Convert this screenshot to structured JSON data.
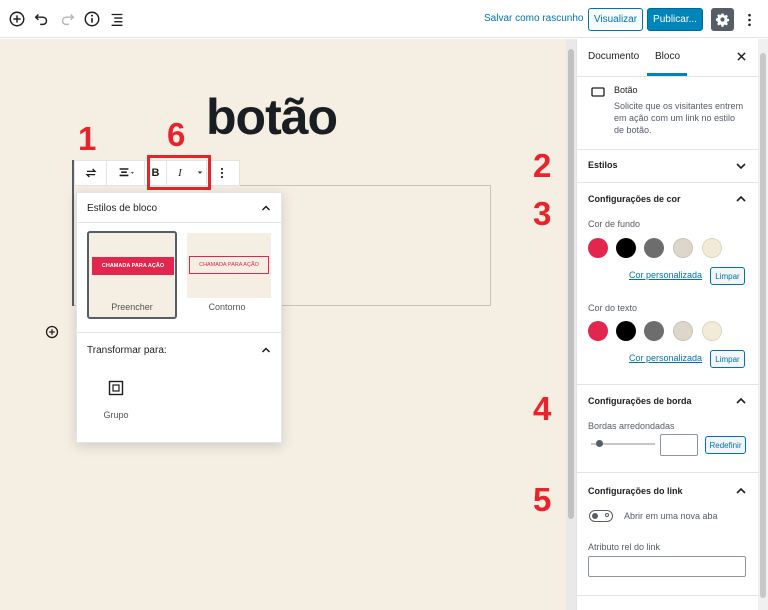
{
  "topbar": {
    "save_draft": "Salvar como rascunho",
    "preview": "Visualizar",
    "publish": "Publicar..."
  },
  "editor": {
    "heading": "botão",
    "styles_panel": {
      "title": "Estilos de bloco",
      "cta_text": "CHAMADA PARA AÇÃO",
      "style_fill": "Preencher",
      "style_outline": "Contorno",
      "transform_title": "Transformar para:",
      "group_label": "Grupo"
    }
  },
  "annotations": [
    "1",
    "6",
    "2",
    "3",
    "4",
    "5"
  ],
  "sidebar": {
    "tab_document": "Documento",
    "tab_block": "Bloco",
    "block_name": "Botão",
    "block_desc": [
      "Solicite que os visitantes entrem",
      "em ação com um link no estilo",
      "de botão."
    ],
    "styles": "Estilos",
    "color_settings": "Configurações de cor",
    "bg_color": "Cor de fundo",
    "text_color": "Cor do texto",
    "custom_color": "Cor personalizada",
    "clear": "Limpar",
    "border_settings": "Configurações de borda",
    "rounded_borders": "Bordas arredondadas",
    "reset": "Redefinir",
    "link_settings": "Configurações do link",
    "open_new_tab": "Abrir em uma nova aba",
    "rel_attr": "Atributo rel do link"
  },
  "colors": {
    "swatches": [
      "#e2264d",
      "#000000",
      "#6d6d6d",
      "#dcd7ca",
      "#f1ebd8"
    ],
    "accent": "#0073aa",
    "annotation": "#e8232b"
  }
}
